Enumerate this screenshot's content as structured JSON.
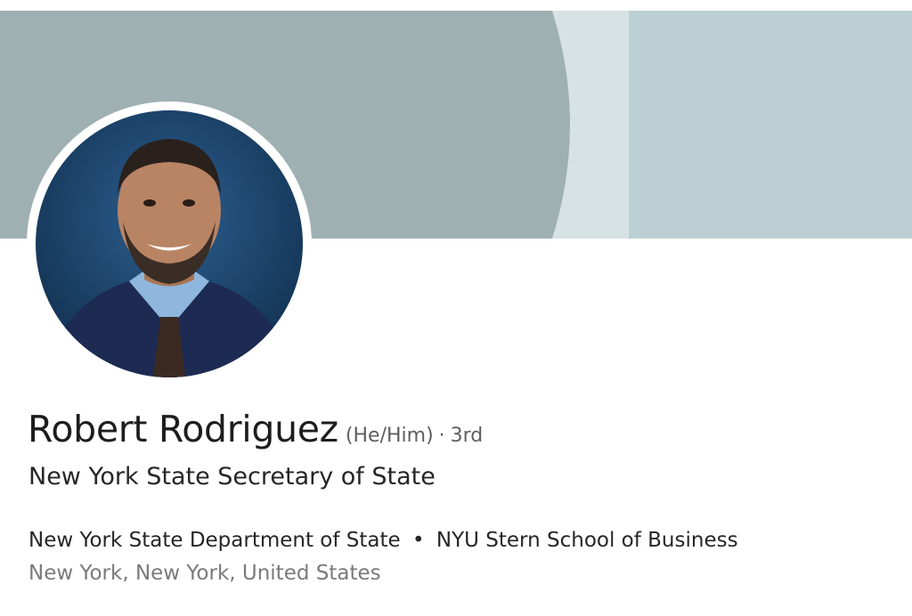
{
  "profile": {
    "name": "Robert Rodriguez",
    "pronouns": "(He/Him)",
    "separator": "·",
    "connection_degree": "3rd",
    "headline": "New York State Secretary of State",
    "organizations": {
      "primary": "New York State Department of State",
      "bullet": "•",
      "secondary": "NYU Stern School of Business"
    },
    "location": "New York, New York, United States"
  },
  "icons": {
    "avatar": "profile-photo",
    "cover": "cover-background"
  },
  "colors": {
    "cover_left": "#9fb0b3",
    "cover_mid": "#d7e2e4",
    "cover_right": "#bcd0d4",
    "text_primary": "#1d1d1d",
    "text_secondary": "#5e5e5e",
    "text_muted": "#7a7a7a"
  }
}
